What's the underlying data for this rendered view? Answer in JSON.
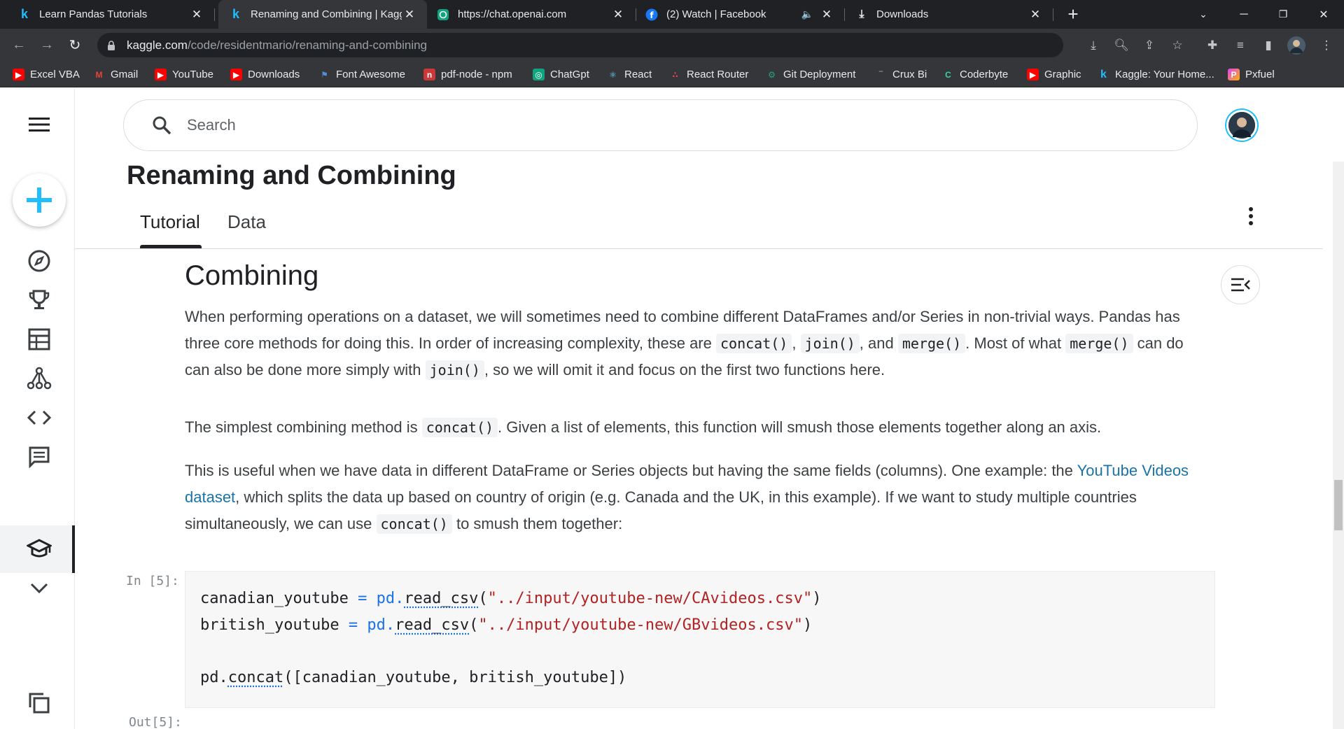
{
  "browser": {
    "tabs": [
      {
        "title": "Learn Pandas Tutorials",
        "icon": "kaggle-k"
      },
      {
        "title": "Renaming and Combining | Kagg",
        "icon": "kaggle-k",
        "active": true
      },
      {
        "title": "https://chat.openai.com",
        "icon": "openai"
      },
      {
        "title": "(2) Watch | Facebook",
        "icon": "facebook",
        "audio": true
      },
      {
        "title": "Downloads",
        "icon": "download"
      }
    ],
    "new_tab": "+",
    "url_host": "kaggle.com",
    "url_path": "/code/residentmario/renaming-and-combining",
    "bookmarks": [
      {
        "label": "Excel VBA",
        "icon": "youtube"
      },
      {
        "label": "Gmail",
        "icon": "gmail"
      },
      {
        "label": "YouTube",
        "icon": "youtube"
      },
      {
        "label": "Downloads",
        "icon": "youtube"
      },
      {
        "label": "Font Awesome",
        "icon": "flag"
      },
      {
        "label": "pdf-node - npm",
        "icon": "npm"
      },
      {
        "label": "ChatGpt",
        "icon": "openai"
      },
      {
        "label": "React",
        "icon": "react"
      },
      {
        "label": "React Router",
        "icon": "react-router"
      },
      {
        "label": "Git Deployment",
        "icon": "gear"
      },
      {
        "label": "Crux Bi",
        "icon": "dash"
      },
      {
        "label": "Coderbyte",
        "icon": "coderbyte"
      },
      {
        "label": "Graphic",
        "icon": "youtube"
      },
      {
        "label": "Kaggle: Your Home...",
        "icon": "kaggle-k"
      },
      {
        "label": "Pxfuel",
        "icon": "pxfuel"
      }
    ]
  },
  "search": {
    "placeholder": "Search"
  },
  "notebook": {
    "title": "Renaming and Combining",
    "tabs": [
      "Tutorial",
      "Data"
    ],
    "section_heading": "Combining",
    "para1": {
      "t1": "When performing operations on a dataset, we will sometimes need to combine different DataFrames and/or Series in non-trivial ways. Pandas has three core methods for doing this. In order of increasing complexity, these are ",
      "c1": "concat()",
      "t2": ", ",
      "c2": "join()",
      "t3": ", and ",
      "c3": "merge()",
      "t4": ". Most of what ",
      "c4": "merge()",
      "t5": " can do can also be done more simply with ",
      "c5": "join()",
      "t6": ", so we will omit it and focus on the first two functions here."
    },
    "para2": {
      "t1": "The simplest combining method is ",
      "c1": "concat()",
      "t2": ". Given a list of elements, this function will smush those elements together along an axis."
    },
    "para3": {
      "t1": "This is useful when we have data in different DataFrame or Series objects but having the same fields (columns). One example: the ",
      "link": "YouTube Videos dataset",
      "t2": ", which splits the data up based on country of origin (e.g. Canada and the UK, in this example). If we want to study multiple countries simultaneously, we can use ",
      "c1": "concat()",
      "t3": " to smush them together:"
    },
    "in_prompt": "In [5]:",
    "out_prompt": "Out[5]:",
    "code": {
      "l1_var": "canadian_youtube",
      "l1_mid": " = pd.",
      "l1_fn": "read_csv",
      "l1_open": "(",
      "l1_str": "\"../input/youtube-new/CAvideos.csv\"",
      "l1_close": ")",
      "l2_var": "british_youtube",
      "l2_mid": " = pd.",
      "l2_fn": "read_csv",
      "l2_open": "(",
      "l2_str": "\"../input/youtube-new/GBvideos.csv\"",
      "l2_close": ")",
      "l3_pre": "pd.",
      "l3_fn": "concat",
      "l3_rest": "([canadian_youtube, british_youtube])"
    }
  },
  "colors": {
    "accent": "#20beff",
    "link": "#1a73a8",
    "string": "#b22222"
  }
}
